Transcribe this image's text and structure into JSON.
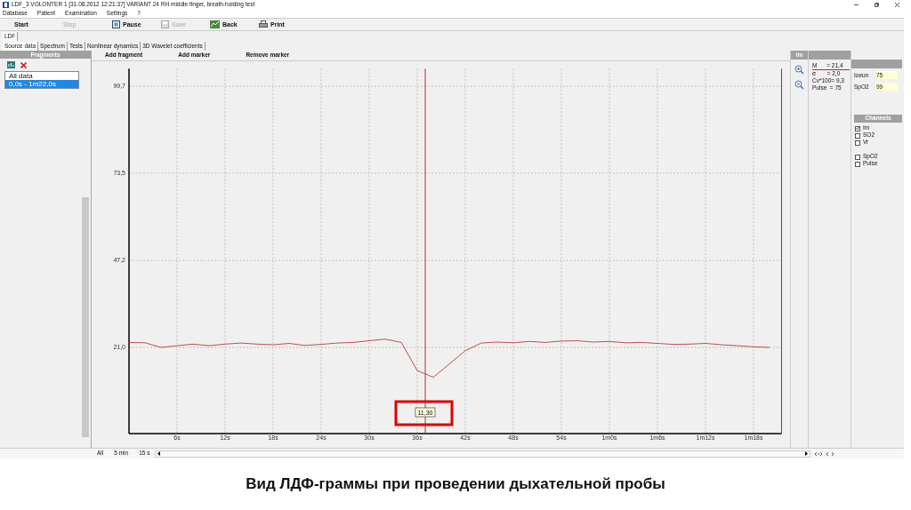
{
  "window": {
    "title": "LDF_3 VOLONTER 1 [31.08.2012 12:21:37] VARIANT 24 RH middle finger, breath-holding test"
  },
  "menu": [
    "Database",
    "Patient",
    "Examination",
    "Settings",
    "?"
  ],
  "toolbar": [
    {
      "label": "Start",
      "kind": "text",
      "disabled": false
    },
    {
      "label": "Stop",
      "kind": "text",
      "disabled": true
    },
    {
      "label": "Pause",
      "kind": "pause",
      "disabled": false
    },
    {
      "label": "Save",
      "kind": "save",
      "disabled": true
    },
    {
      "label": "Back",
      "kind": "back",
      "disabled": false
    },
    {
      "label": "Print",
      "kind": "print",
      "disabled": false
    }
  ],
  "top_tabs": [
    {
      "label": "LDF",
      "selected": true
    }
  ],
  "tabs": [
    {
      "label": "Source data",
      "selected": true
    },
    {
      "label": "Spectrum",
      "selected": false
    },
    {
      "label": "Tests",
      "selected": false
    },
    {
      "label": "Nonlinear dynamics",
      "selected": false
    },
    {
      "label": "3D Wavelet coefficients",
      "selected": false
    }
  ],
  "fragments": {
    "title": "Fragments",
    "items": [
      {
        "label": "All data",
        "selected": false
      },
      {
        "label": "0,0s - 1m22,0s",
        "selected": true
      }
    ]
  },
  "chart_toolbar": [
    "Add fragment",
    "Add marker",
    "Remove marker"
  ],
  "chart": {
    "chart_data": {
      "type": "line",
      "xlim": [
        0,
        81.5
      ],
      "ylim": [
        -5,
        105
      ],
      "yticks": [
        {
          "value": 99.7,
          "label": "99,7"
        },
        {
          "value": 73.5,
          "label": "73,5"
        },
        {
          "value": 47.2,
          "label": "47,2"
        },
        {
          "value": 21.0,
          "label": "21,0"
        }
      ],
      "xticks": [
        {
          "value": 6,
          "label": "6s"
        },
        {
          "value": 12,
          "label": "12s"
        },
        {
          "value": 18,
          "label": "18s"
        },
        {
          "value": 24,
          "label": "24s"
        },
        {
          "value": 30,
          "label": "30s"
        },
        {
          "value": 36,
          "label": "36s"
        },
        {
          "value": 42,
          "label": "42s"
        },
        {
          "value": 48,
          "label": "48s"
        },
        {
          "value": 54,
          "label": "54s"
        },
        {
          "value": 60,
          "label": "1m0s"
        },
        {
          "value": 66,
          "label": "1m6s"
        },
        {
          "value": 72,
          "label": "1m12s"
        },
        {
          "value": 78,
          "label": "1m18s"
        }
      ],
      "x": [
        0,
        2,
        4,
        6,
        8,
        10,
        12,
        14,
        16,
        18,
        20,
        22,
        24,
        26,
        28,
        30,
        32,
        34,
        36,
        38,
        40,
        42,
        44,
        46,
        48,
        50,
        52,
        54,
        56,
        58,
        60,
        62,
        64,
        66,
        68,
        70,
        72,
        74,
        76,
        78,
        80
      ],
      "series": [
        {
          "name": "Im",
          "color": "#c0504d",
          "values": [
            22.5,
            22.4,
            21.0,
            21.5,
            22.0,
            21.5,
            22.0,
            22.3,
            22.0,
            21.8,
            22.2,
            21.6,
            21.9,
            22.3,
            22.5,
            23.0,
            23.5,
            22.5,
            14.0,
            12.0,
            16.0,
            20.0,
            22.3,
            22.6,
            22.4,
            22.8,
            22.5,
            22.9,
            23.0,
            22.6,
            22.8,
            22.4,
            22.5,
            22.2,
            21.9,
            22.0,
            22.2,
            21.8,
            21.5,
            21.2,
            21.0
          ]
        }
      ],
      "grid": true,
      "ref_lines": [
        {
          "axis": "x",
          "value": 37,
          "color": "#b03030"
        }
      ],
      "annotations": [
        "11,30"
      ]
    }
  },
  "stats": [
    "M      = 21,4",
    "σ       = 2,0",
    "Cv*100= 9,3",
    "Pulse  = 75"
  ],
  "fields": [
    {
      "label": "Ioeun",
      "value": "75"
    },
    {
      "label": "SpO2",
      "value": "99"
    }
  ],
  "channels": {
    "title": "Channels",
    "groups": [
      [
        {
          "label": "Im",
          "checked": true
        },
        {
          "label": "SO2",
          "checked": false
        },
        {
          "label": "Vr",
          "checked": false
        }
      ],
      [
        {
          "label": "SpO2",
          "checked": false
        },
        {
          "label": "Pulse",
          "checked": false
        }
      ]
    ]
  },
  "scale_buttons": [
    "All",
    "5 min",
    "15 s"
  ],
  "caption": "Вид ЛДФ-граммы при проведении дыхательной пробы"
}
